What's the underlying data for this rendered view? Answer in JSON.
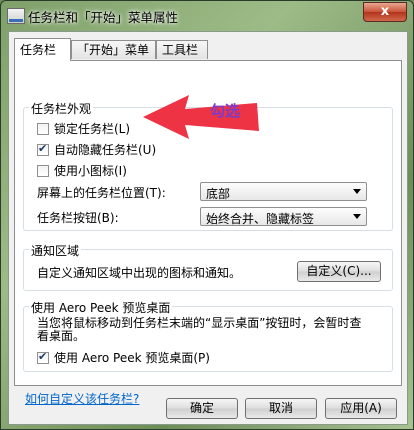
{
  "window": {
    "title": "任务栏和「开始」菜单属性",
    "close_label": "x"
  },
  "tabs": [
    {
      "label": "任务栏",
      "active": true
    },
    {
      "label": "「开始」菜单",
      "active": false
    },
    {
      "label": "工具栏",
      "active": false
    }
  ],
  "appearance": {
    "title": "任务栏外观",
    "lock": {
      "label": "锁定任务栏(L)",
      "checked": false
    },
    "autohide": {
      "label": "自动隐藏任务栏(U)",
      "checked": true
    },
    "small_icons": {
      "label": "使用小图标(I)",
      "checked": false
    },
    "location_label": "屏幕上的任务栏位置(T):",
    "location_value": "底部",
    "buttons_label": "任务栏按钮(B):",
    "buttons_value": "始终合并、隐藏标签"
  },
  "notification": {
    "title": "通知区域",
    "description": "自定义通知区域中出现的图标和通知。",
    "customize_button": "自定义(C)..."
  },
  "peek": {
    "title": "使用 Aero Peek 预览桌面",
    "description": "当您将鼠标移动到任务栏末端的“显示桌面”按钮时，会暂时查看桌面。",
    "checkbox": {
      "label": "使用 Aero Peek 预览桌面(P)",
      "checked": true
    }
  },
  "help_link": "如何自定义该任务栏?",
  "footer": {
    "ok": "确定",
    "cancel": "取消",
    "apply": "应用(A)"
  },
  "annotation": {
    "text": "勾选",
    "color": "#ee3344"
  }
}
